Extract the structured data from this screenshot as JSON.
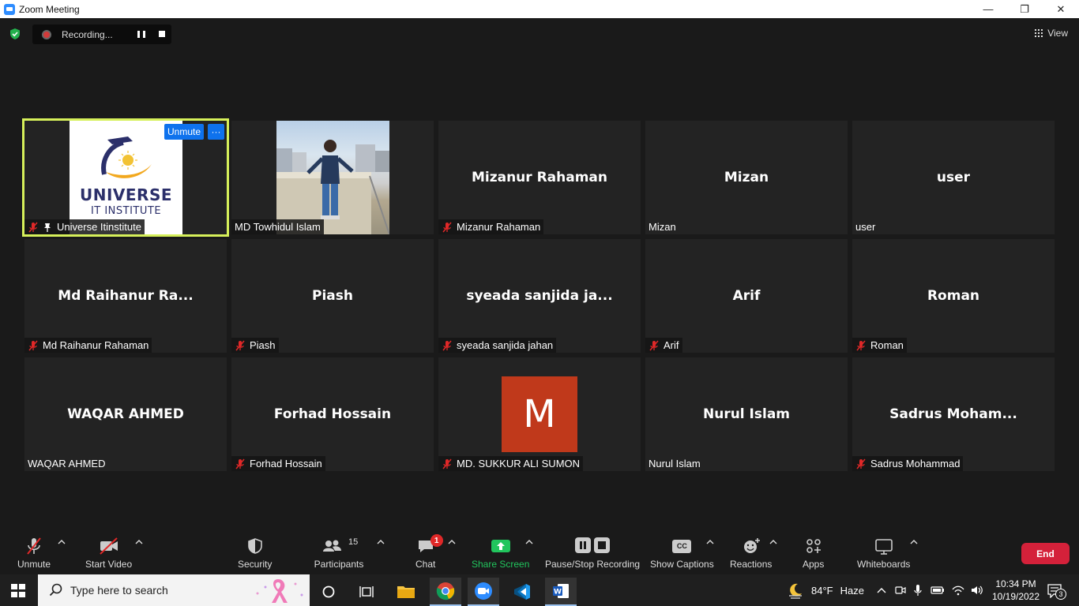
{
  "window": {
    "title": "Zoom Meeting",
    "minimize": "—",
    "restore": "❐",
    "close": "✕"
  },
  "topbar": {
    "recording_label": "Recording...",
    "view_label": "View"
  },
  "participants": [
    {
      "display": "",
      "label": "Universe Itinstitute",
      "muted": true,
      "pinned": true,
      "type": "logo",
      "logo_line1": "UNIVERSE",
      "logo_line2": "IT INSTITUTE"
    },
    {
      "display": "",
      "label": "MD Towhidul Islam",
      "muted": false,
      "type": "video"
    },
    {
      "display": "Mizanur Rahaman",
      "label": "Mizanur Rahaman",
      "muted": true
    },
    {
      "display": "Mizan",
      "label": "Mizan",
      "muted": false
    },
    {
      "display": "user",
      "label": "user",
      "muted": false
    },
    {
      "display": "Md  Raihanur  Ra...",
      "label": "Md Raihanur Rahaman",
      "muted": true
    },
    {
      "display": "Piash",
      "label": "Piash",
      "muted": true
    },
    {
      "display": "syeada  sanjida  ja...",
      "label": "syeada sanjida jahan",
      "muted": true
    },
    {
      "display": "Arif",
      "label": "Arif",
      "muted": true
    },
    {
      "display": "Roman",
      "label": "Roman",
      "muted": true
    },
    {
      "display": "WAQAR AHMED",
      "label": "WAQAR AHMED",
      "muted": false
    },
    {
      "display": "Forhad Hossain",
      "label": "Forhad Hossain",
      "muted": true
    },
    {
      "display": "",
      "label": "MD. SUKKUR ALI SUMON",
      "muted": true,
      "type": "avatar",
      "avatar_letter": "M",
      "avatar_color": "#c0391b"
    },
    {
      "display": "Nurul Islam",
      "label": "Nurul Islam",
      "muted": false
    },
    {
      "display": "Sadrus  Moham...",
      "label": "Sadrus Mohammad",
      "muted": true
    }
  ],
  "active_tile": {
    "unmute_label": "Unmute",
    "more_label": "···"
  },
  "toolbar": {
    "unmute": "Unmute",
    "start_video": "Start Video",
    "security": "Security",
    "participants": "Participants",
    "participants_count": "15",
    "chat": "Chat",
    "chat_badge": "1",
    "share_screen": "Share Screen",
    "pause_stop_recording": "Pause/Stop Recording",
    "show_captions": "Show Captions",
    "captions_icon_text": "CC",
    "reactions": "Reactions",
    "apps": "Apps",
    "whiteboards": "Whiteboards",
    "end": "End"
  },
  "taskbar": {
    "search_placeholder": "Type here to search",
    "weather_temp": "84°F",
    "weather_cond": "Haze",
    "time": "10:34 PM",
    "date": "10/19/2022",
    "notification_count": "3"
  },
  "colors": {
    "accent_blue": "#0e72ed",
    "active_border": "#d6f05a",
    "share_green": "#21c55d",
    "end_red": "#d4213a",
    "mute_red": "#e02828"
  }
}
